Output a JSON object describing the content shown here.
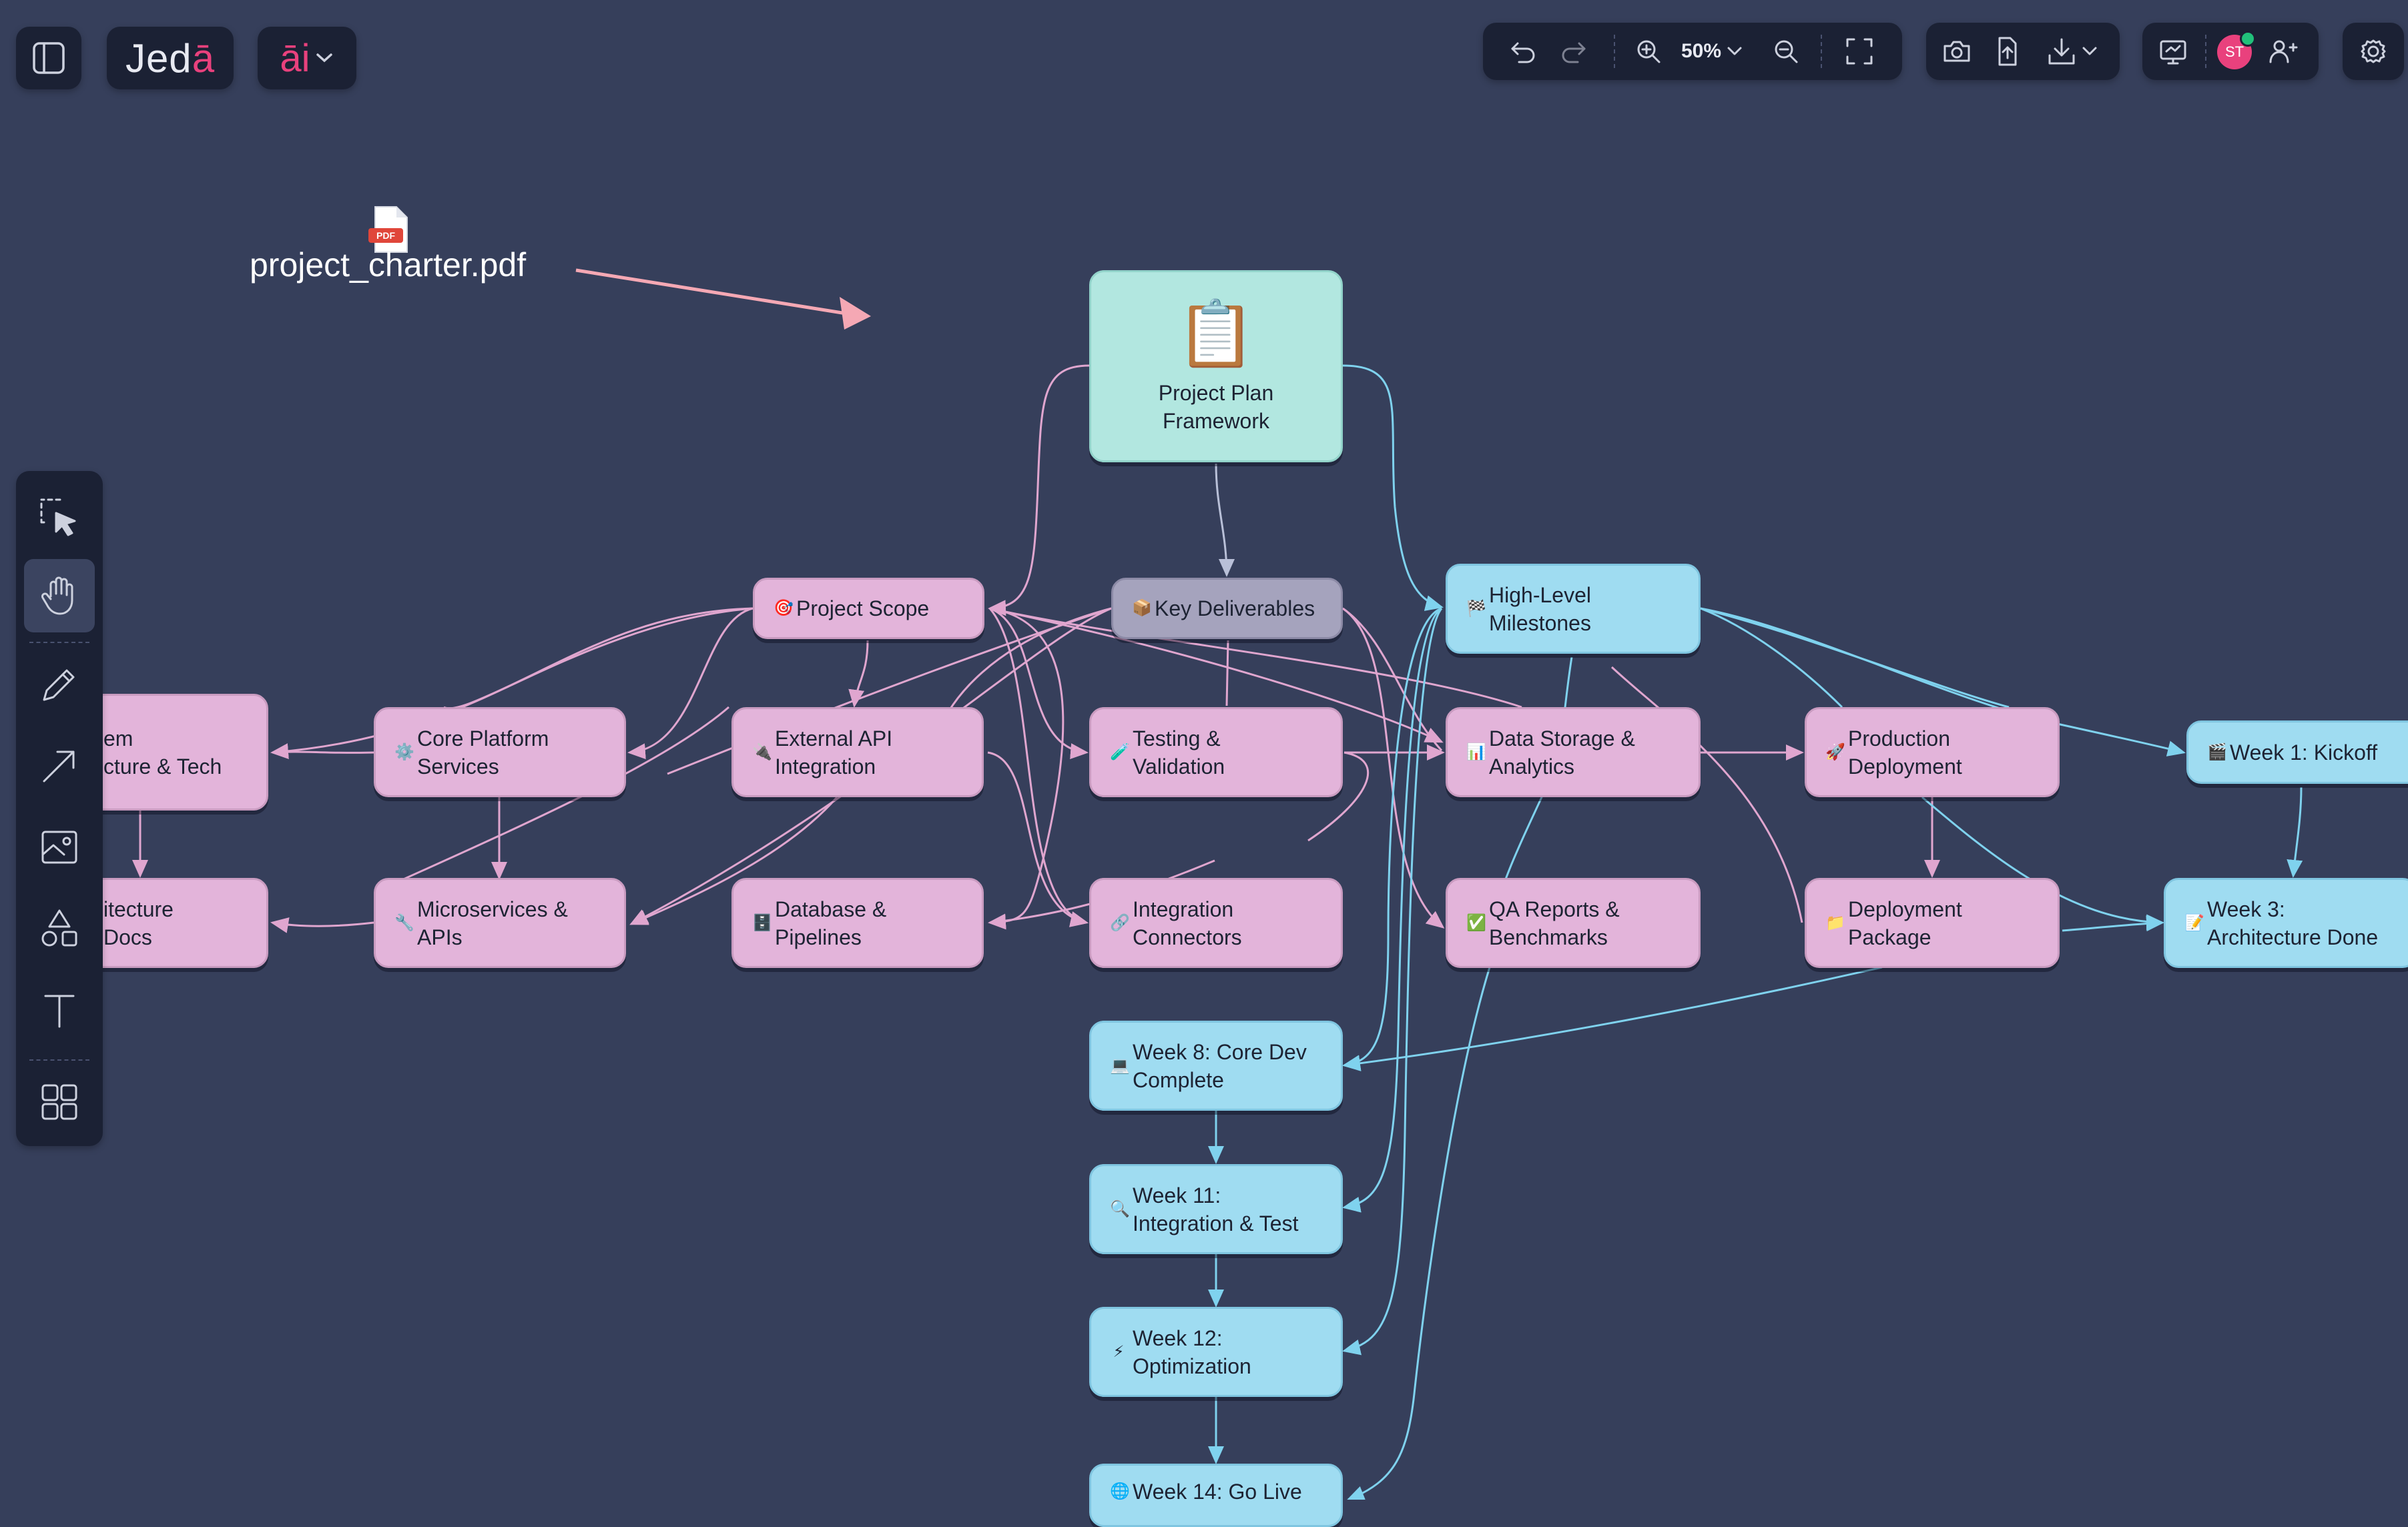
{
  "app": {
    "logo": "Jedā",
    "ai_label": "āi",
    "zoom": "50%",
    "avatar_initials": "ST",
    "colors": {
      "background": "#363f5b",
      "toolbar": "#1b2134",
      "pink_node": "#e3b4da",
      "blue_node": "#9fdcf1",
      "grey_node": "#a5a3bd",
      "teal_node": "#b2e7e0",
      "connector_pink": "#e0a6cf",
      "connector_blue": "#7fd2ee",
      "arrow_pink": "#f5a8b4",
      "avatar": "#e9417d"
    }
  },
  "toolbar": {
    "undo": "undo-icon",
    "redo": "redo-icon",
    "zoom_in": "zoom-in-icon",
    "zoom_out": "zoom-out-icon",
    "fit": "fit-screen-icon",
    "screenshot": "camera-icon",
    "share": "share-icon",
    "download": "download-icon",
    "present": "present-icon",
    "add_user": "add-user-icon",
    "settings": "gear-icon"
  },
  "left_tools": [
    "select-icon",
    "hand-icon",
    "pencil-icon",
    "arrow-icon",
    "image-icon",
    "shapes-icon",
    "text-icon",
    "grid-icon"
  ],
  "file": {
    "name": "project_charter.pdf",
    "badge": "PDF"
  },
  "nodes": {
    "framework": {
      "icon": "📋",
      "title": "Project Plan\nFramework"
    },
    "scope": {
      "icon": "🎯",
      "label": "Project Scope"
    },
    "deliverables": {
      "icon": "📦",
      "label": "Key Deliverables"
    },
    "milestones": {
      "icon": "🏁",
      "label": "High-Level\nMilestones"
    },
    "sys_arch": {
      "icon": "",
      "label": "em\ncture & Tech"
    },
    "core_platform": {
      "icon": "⚙️",
      "label": "Core Platform\nServices"
    },
    "external_api": {
      "icon": "🔌",
      "label": "External API\nIntegration"
    },
    "testing": {
      "icon": "🧪",
      "label": "Testing &\nValidation"
    },
    "data_storage": {
      "icon": "📊",
      "label": "Data Storage &\nAnalytics"
    },
    "prod_deploy": {
      "icon": "🚀",
      "label": "Production\nDeployment"
    },
    "week1": {
      "icon": "🎬",
      "label": "Week 1: Kickoff"
    },
    "arch_docs": {
      "icon": "",
      "label": "itecture\nDocs"
    },
    "microservices": {
      "icon": "🔧",
      "label": "Microservices &\nAPIs"
    },
    "database": {
      "icon": "🗄️",
      "label": "Database &\nPipelines"
    },
    "integration": {
      "icon": "🔗",
      "label": "Integration\nConnectors"
    },
    "qa_reports": {
      "icon": "✅",
      "label": "QA Reports &\nBenchmarks"
    },
    "deploy_pkg": {
      "icon": "📁",
      "label": "Deployment\nPackage"
    },
    "week3": {
      "icon": "📝",
      "label": "Week 3:\nArchitecture Done"
    },
    "week8": {
      "icon": "💻",
      "label": "Week 8: Core Dev\nComplete"
    },
    "week11": {
      "icon": "🔍",
      "label": "Week 11:\nIntegration & Test"
    },
    "week12": {
      "icon": "⚡",
      "label": "Week 12:\nOptimization"
    },
    "week14": {
      "icon": "🌐",
      "label": "Week 14: Go Live"
    }
  }
}
